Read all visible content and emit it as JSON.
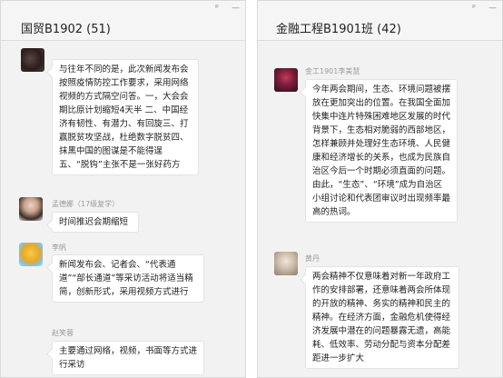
{
  "left_window": {
    "title": "国贸B1902 (51)",
    "controls": [
      "ᵖ",
      "—"
    ],
    "messages": [
      {
        "sender": "",
        "text": "与往年不同的是，此次新闻发布会按照疫情防控工作要求，采用网络视频的方式隔空问答。一，大会会期比原计划缩短4天半 二、中国经济有韧性、有潜力、有回旋三、打赢脱贫攻坚战，杜绝数字脱贫四、抹黑中国的图谋是不能得逞五、“脱钩”主张不是一张好药方"
      },
      {
        "sender": "孟德娜（17级复学）",
        "text": "时间推迟会期缩短"
      },
      {
        "sender": "李帆",
        "text": "新闻发布会、记者会、“代表通道”“部长通道”等采访活动将适当精简，创新形式，采用视频方式进行"
      },
      {
        "sender": "赵笑蓉",
        "text": "主要通过网络，视频，书面等方式进行采访"
      }
    ]
  },
  "right_window": {
    "title": "金融工程B1901班 (42)",
    "controls": [
      "ᵖ",
      "—"
    ],
    "messages": [
      {
        "sender": "金工1901李美慧",
        "text": "今年两会期间，生态、环境问题被摆放在更加突出的位置。在我国全面加快集中连片特殊困难地区发展的时代背景下，生态相对脆弱的西部地区，怎样兼顾并处理好生态环境、人民健康和经济增长的关系，也成为民族自治区今后一个时期必须直面的问题。由此，“生态”、“环境”成为自治区小组讨论和代表团审议时出现频率最高的热词。"
      },
      {
        "sender": "黄丹",
        "text": "两会精神不仅意味着对新一年政府工作的安排部署，还意味着两会所体现的开放的精神、务实的精神和民主的精神。在经济方面，金融危机使得经济发展中潜在的问题暴露无遗，高能耗、低效率、劳动分配与资本分配差距进一步扩大"
      }
    ]
  }
}
